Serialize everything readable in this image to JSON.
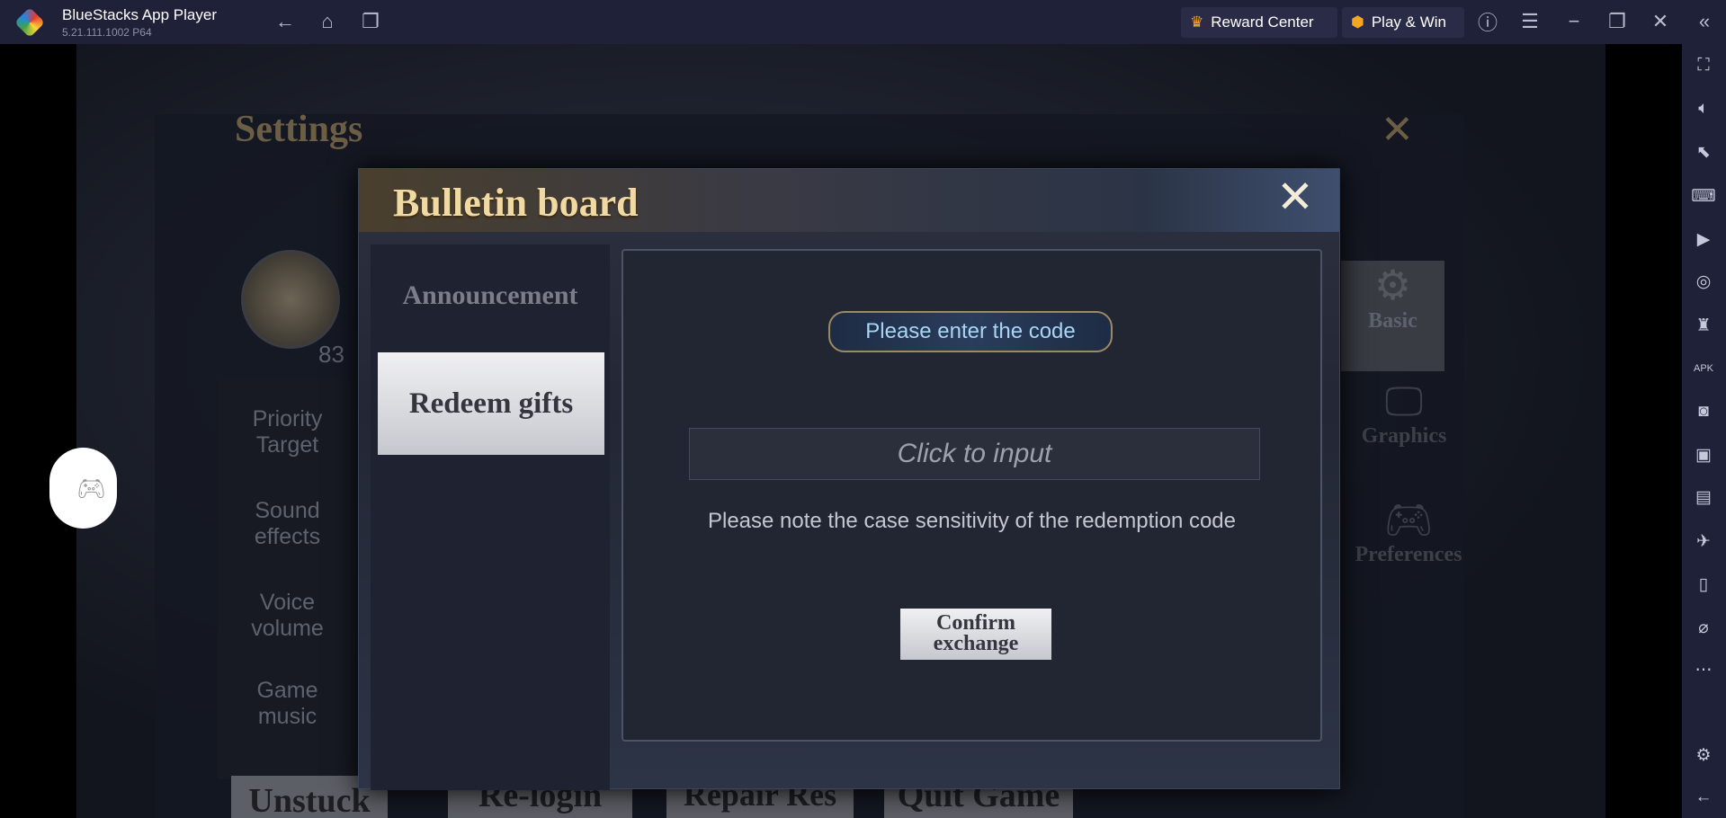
{
  "titlebar": {
    "app_name": "BlueStacks App Player",
    "version": "5.21.111.1002  P64",
    "reward_center": "Reward Center",
    "play_win": "Play & Win",
    "icons": [
      "back-icon",
      "home-icon",
      "multi-instance-icon",
      "help-icon",
      "menu-icon",
      "minimize-icon",
      "restore-icon",
      "close-icon",
      "collapse-sidebar-icon"
    ]
  },
  "sidebar": {
    "icons": [
      "fullscreen-icon",
      "volume-icon",
      "pointer-icon",
      "keyboard-icon",
      "macro-icon",
      "sync-icon",
      "game-controls-icon",
      "apk-install-icon",
      "screenshot-icon",
      "record-icon",
      "media-folder-icon",
      "airplane-mode-icon",
      "rotate-icon",
      "eco-mode-icon",
      "more-icon",
      "settings-icon",
      "back-icon"
    ]
  },
  "settings": {
    "title": "Settings",
    "level": "83",
    "menu": [
      "Priority\nTarget",
      "Sound\neffects",
      "Voice\nvolume",
      "Game\nmusic"
    ],
    "tabs": [
      "Basic",
      "Graphics",
      "Preferences"
    ],
    "bottom_buttons": [
      "Unstuck",
      "Re-login",
      "Repair Res",
      "Quit Game"
    ]
  },
  "bulletin": {
    "title": "Bulletin board",
    "tabs": [
      "Announcement",
      "Redeem gifts"
    ],
    "active_tab": "Redeem gifts",
    "code_label": "Please enter the code",
    "input_placeholder": "Click to input",
    "note": "Please note the case sensitivity of the redemption code",
    "confirm": "Confirm\nexchange"
  },
  "colors": {
    "titlebar": "#1f2138",
    "gold": "#f0d9a3",
    "code_label": "#a9d4f5"
  }
}
